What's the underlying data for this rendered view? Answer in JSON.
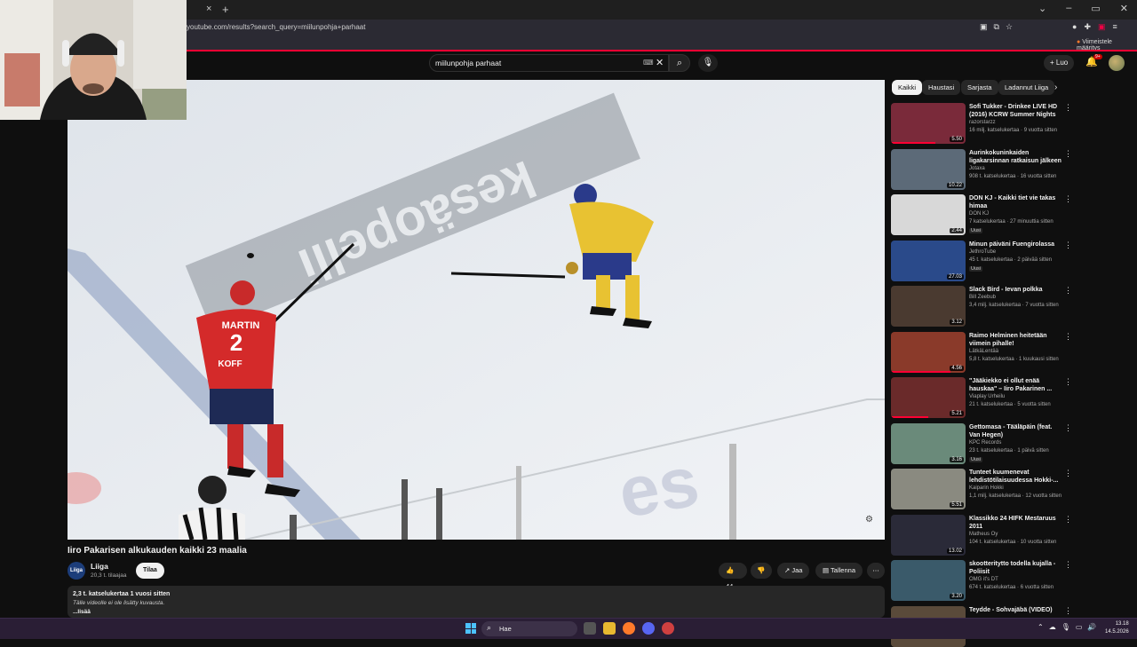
{
  "browser": {
    "url": "youtube.com/results?search_query=miilunpohja+parhaat",
    "bookmark": "Viimeistele määritys",
    "tab_close": "×",
    "new_tab": "+",
    "win_min": "–",
    "win_max": "▭",
    "win_close": "✕",
    "win_dropdown": "⌄"
  },
  "header": {
    "search_value": "miilunpohja parhaat",
    "create_label": "Luo",
    "notif_badge": "9+"
  },
  "video": {
    "title": "Iiro Pakarisen alkukauden kaikki 23 maalia",
    "channel": "Liiga",
    "channel_avatar_text": "Liiga",
    "subscribers": "20,3 t. tilaajaa",
    "subscribe_label": "Tilaa",
    "likes": "44",
    "share_label": "Jaa",
    "save_label": "Tallenna",
    "desc_views": "2,3 t. katselukertaa  1 vuosi sitten",
    "desc_text": "Tälle videolle ei ole lisätty kuvausta.",
    "desc_more": "...lisää",
    "rink_text": "kesäopelli",
    "player_left_name": "MARTIN",
    "player_left_number": "2",
    "player_left_sponsor": "KOFF"
  },
  "chips": [
    "Kaikki",
    "Haustasi",
    "Sarjasta",
    "Ladannut Liiga"
  ],
  "recommendations": [
    {
      "title": "Sofi Tukker - Drinkee LIVE HD (2016) KCRW Summer Nights ...",
      "channel": "razorstarzz",
      "meta": "16 milj. katselukertaa · 9 vuotta sitten",
      "duration": "5.50",
      "new": "",
      "color": "#7a2a3a",
      "progress": 0.6
    },
    {
      "title": "Aurinkokuninkaiden ligakarsinnan ratkaisun jälkeen",
      "channel": "Jotaxa",
      "meta": "908 t. katselukertaa · 16 vuotta sitten",
      "duration": "10.22",
      "new": "",
      "color": "#5c6a78",
      "progress": 0
    },
    {
      "title": "DON KJ - Kaikki tiet vie takas himaa",
      "channel": "DON KJ",
      "meta": "7 katselukertaa · 27 minuuttia sitten",
      "duration": "2.44",
      "new": "Uusi",
      "color": "#d8d8d8",
      "progress": 0
    },
    {
      "title": "Minun päiväni Fuengirolassa",
      "channel": "JethroTube",
      "meta": "45 t. katselukertaa · 2 päivää sitten",
      "duration": "27.03",
      "new": "Uusi",
      "color": "#2a4a8a",
      "progress": 0
    },
    {
      "title": "Slack Bird - Ievan polkka",
      "channel": "Bill Zeebub",
      "meta": "3,4 milj. katselukertaa · 7 vuotta sitten",
      "duration": "3.12",
      "new": "",
      "color": "#4a3a30",
      "progress": 0
    },
    {
      "title": "Raimo Helminen heitetään viimein pihalle!",
      "channel": "LätkäLentää",
      "meta": "5,8 t. katselukertaa · 1 kuukausi sitten",
      "duration": "4.56",
      "new": "",
      "color": "#8a3a2a",
      "progress": 0.8
    },
    {
      "title": "\"Jääkiekko ei ollut enää hauskaa\" – Iiro Pakarinen ...",
      "channel": "Viaplay Urheilu",
      "meta": "21 t. katselukertaa · 5 vuotta sitten",
      "duration": "5.21",
      "new": "",
      "color": "#6a2a2a",
      "progress": 0.5
    },
    {
      "title": "Gettomasa - Tääläpäin (feat. Van Hegen)",
      "channel": "KPC Records",
      "meta": "23 t. katselukertaa · 1 päivä sitten",
      "duration": "3.16",
      "new": "Uusi",
      "color": "#6a8a7a",
      "progress": 0
    },
    {
      "title": "Tunteet kuumenevat lehdistötilaisuudessa Hokki-...",
      "channel": "Kaiparin Hokki",
      "meta": "1,1 milj. katselukertaa · 12 vuotta sitten",
      "duration": "5.51",
      "new": "",
      "color": "#8a8a80",
      "progress": 0
    },
    {
      "title": "Klassikko 24 HIFK Mestaruus 2011",
      "channel": "Matheus Oy",
      "meta": "104 t. katselukertaa · 10 vuotta sitten",
      "duration": "13.02",
      "new": "",
      "color": "#2a2a38",
      "progress": 0
    },
    {
      "title": "skootteritytto todella kujalla - Poliisit",
      "channel": "OMG it's DT",
      "meta": "674 t. katselukertaa · 6 vuotta sitten",
      "duration": "3.20",
      "new": "",
      "color": "#3a5a6a",
      "progress": 0
    },
    {
      "title": "Teydde - Sohvajäbä (VIDEO)",
      "channel": "",
      "meta": "",
      "duration": "",
      "new": "",
      "color": "#5a4a3a",
      "progress": 0
    }
  ],
  "taskbar": {
    "search_label": "Hae",
    "time": "13.18",
    "date": "14.5.2026"
  }
}
